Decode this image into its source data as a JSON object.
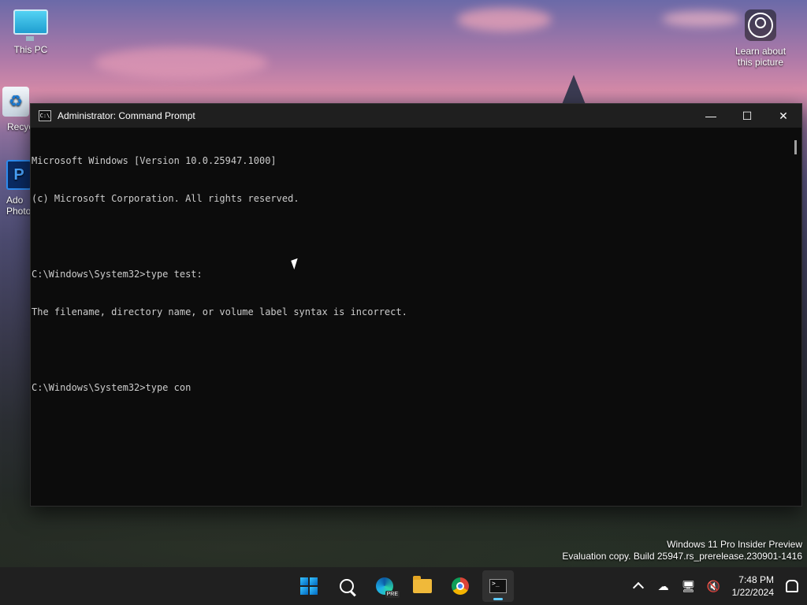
{
  "desktop": {
    "icons": [
      {
        "label": "This PC"
      },
      {
        "label": "Recyc"
      },
      {
        "label": "Ado\nPhoto"
      }
    ],
    "learn_label": "Learn about this picture"
  },
  "window": {
    "title": "Administrator: Command Prompt",
    "icon_text": "C:\\",
    "console_lines": [
      "Microsoft Windows [Version 10.0.25947.1000]",
      "(c) Microsoft Corporation. All rights reserved.",
      "",
      "C:\\Windows\\System32>type test:",
      "The filename, directory name, or volume label syntax is incorrect.",
      "",
      "C:\\Windows\\System32>type con"
    ],
    "controls": {
      "minimize": "—",
      "maximize": "☐",
      "close": "✕"
    }
  },
  "watermark": {
    "line1": "Windows 11 Pro Insider Preview",
    "line2": "Evaluation copy. Build 25947.rs_prerelease.230901-1416"
  },
  "taskbar": {
    "apps": [
      {
        "name": "start",
        "icon": "windows-logo-icon"
      },
      {
        "name": "search",
        "icon": "search-icon"
      },
      {
        "name": "edge",
        "icon": "edge-icon",
        "badge": "PRE"
      },
      {
        "name": "file-explorer",
        "icon": "folder-icon"
      },
      {
        "name": "chrome",
        "icon": "chrome-icon"
      },
      {
        "name": "terminal",
        "icon": "terminal-icon",
        "active": true
      }
    ],
    "clock": {
      "time": "7:48 PM",
      "date": "1/22/2024"
    },
    "accent": "#60cdff"
  }
}
